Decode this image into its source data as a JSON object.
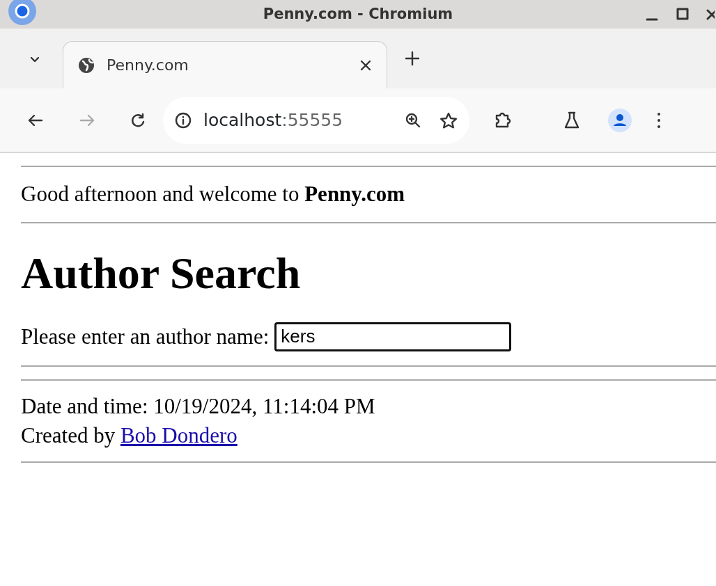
{
  "window": {
    "title": "Penny.com - Chromium"
  },
  "tabs": [
    {
      "label": "Penny.com",
      "selected": true
    }
  ],
  "address": {
    "host": "localhost",
    "port": ":55555"
  },
  "page": {
    "greeting": "Good afternoon and welcome to **Penny.com**",
    "heading": "Author Search",
    "search": {
      "label": "Please enter an author name:",
      "value": "kers"
    },
    "datetime": "Date and time: 10/19/2024, 11:14:04 PM",
    "created_by": "Created by",
    "author_link": "Bob Dondero"
  }
}
